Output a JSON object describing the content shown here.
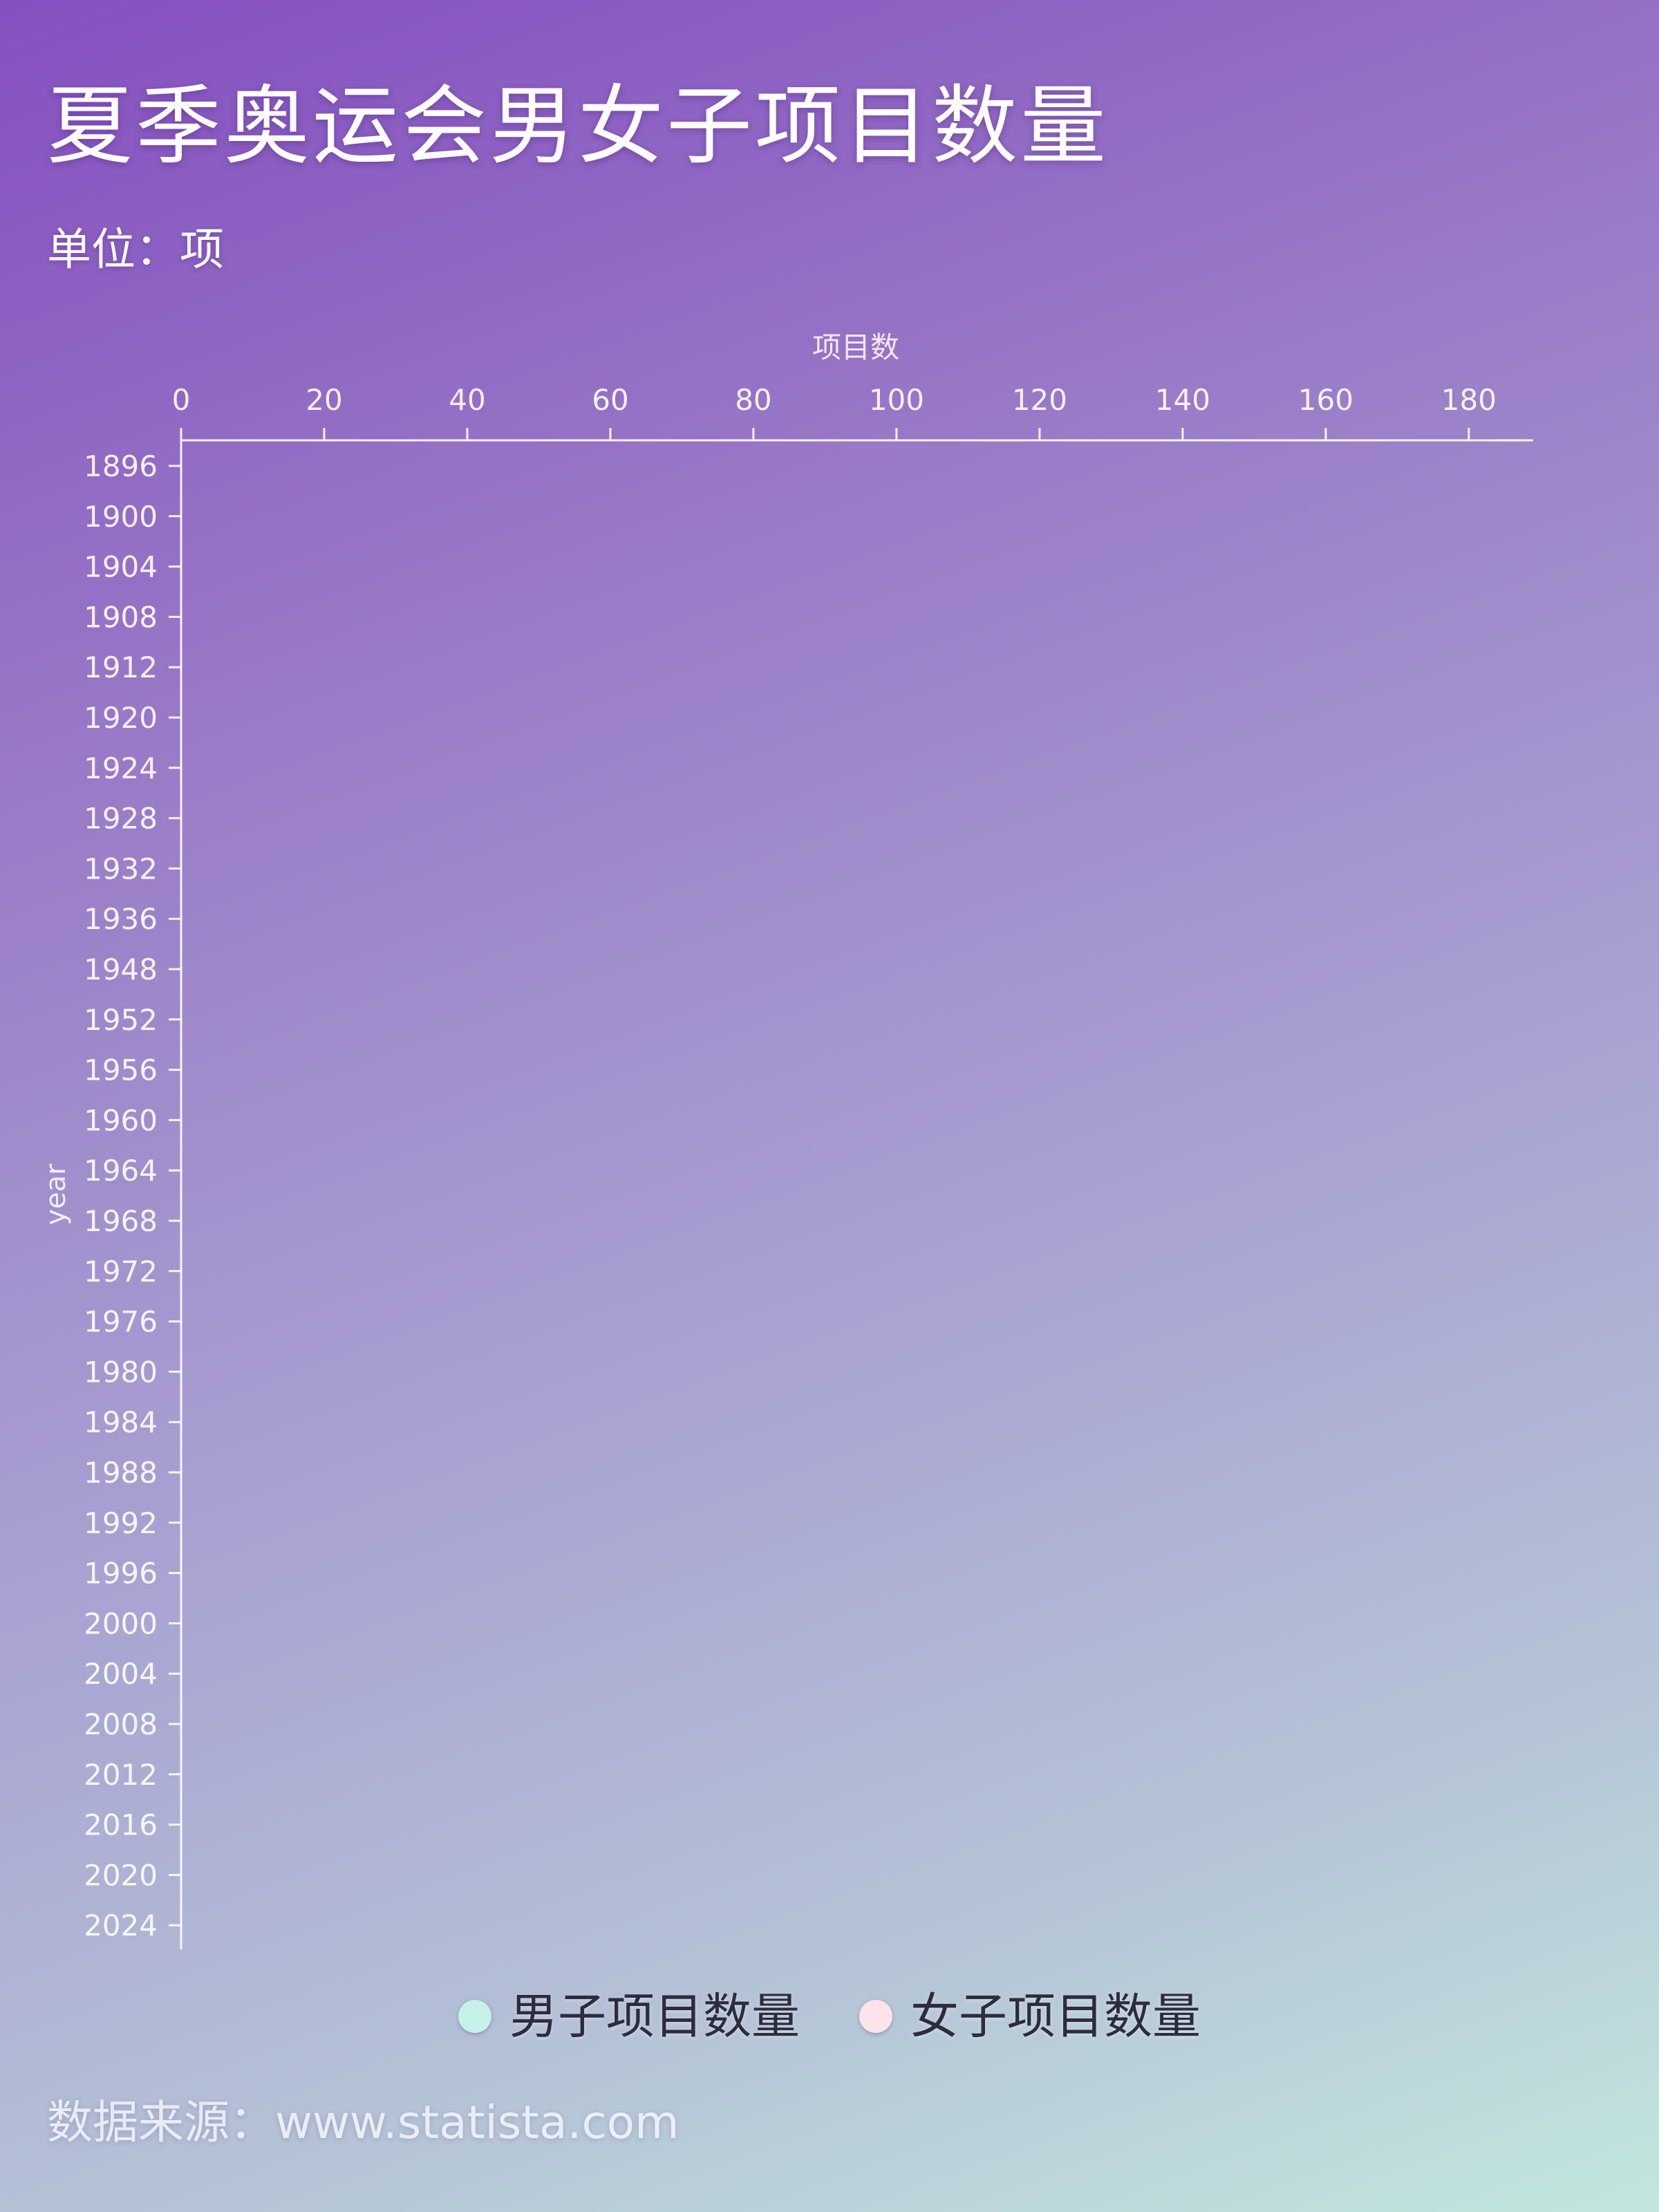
{
  "title": "夏季奥运会男女子项目数量",
  "subtitle": "单位：项",
  "source": "数据来源：www.statista.com",
  "colors": {
    "axis": "#ffffff",
    "men": "#c5f2e8",
    "women": "#fde3ea",
    "legend_text": "#2f2b3f"
  },
  "legend": [
    {
      "label": "男子项目数量",
      "color": "#c5f2e8"
    },
    {
      "label": "女子项目数量",
      "color": "#fde3ea"
    }
  ],
  "chart_data": {
    "type": "bar",
    "orientation": "horizontal",
    "xlabel": "项目数",
    "ylabel": "year",
    "xlim": [
      0,
      189
    ],
    "xticks": [
      0,
      20,
      40,
      60,
      80,
      100,
      120,
      140,
      160,
      180
    ],
    "x_axis_position": "top",
    "categories": [
      "1896",
      "1900",
      "1904",
      "1908",
      "1912",
      "1920",
      "1924",
      "1928",
      "1932",
      "1936",
      "1948",
      "1952",
      "1956",
      "1960",
      "1964",
      "1968",
      "1972",
      "1976",
      "1980",
      "1984",
      "1988",
      "1992",
      "1996",
      "2000",
      "2004",
      "2008",
      "2012",
      "2016",
      "2020",
      "2024"
    ],
    "series": [
      {
        "name": "男子项目数量",
        "values": [],
        "color": "#c5f2e8"
      },
      {
        "name": "女子项目数量",
        "values": [],
        "color": "#fde3ea"
      }
    ],
    "grid": false,
    "legend_position": "bottom"
  }
}
